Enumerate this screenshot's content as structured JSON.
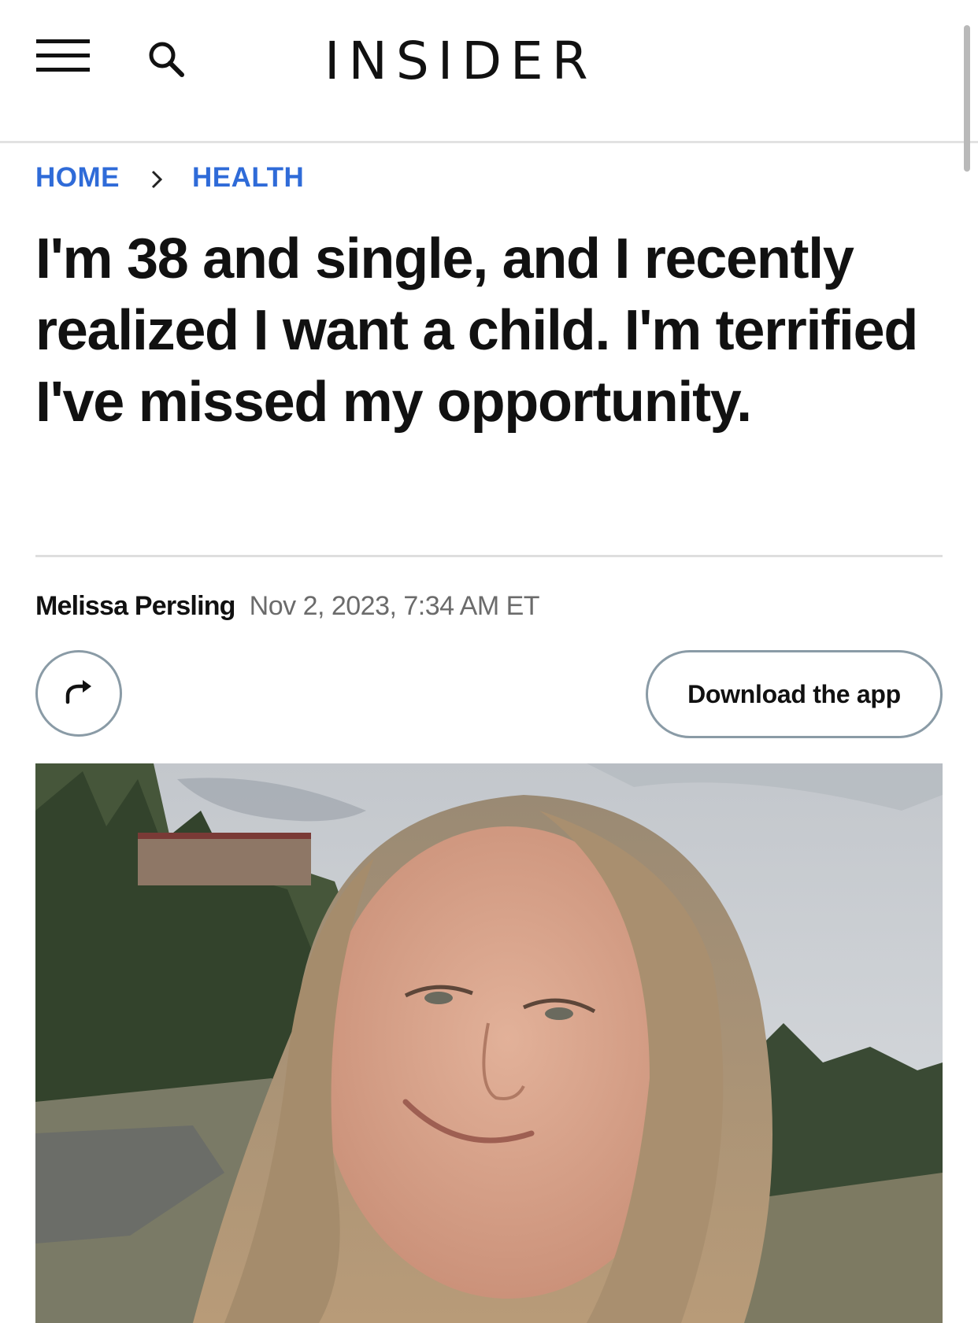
{
  "header": {
    "logo": "INSIDER",
    "menu_icon": "hamburger-menu-icon",
    "search_icon": "search-icon"
  },
  "breadcrumb": {
    "home": "HOME",
    "separator_icon": "chevron-right-icon",
    "section": "HEALTH"
  },
  "article": {
    "headline": "I'm 38 and single, and I recently realized I want a child. I'm terrified I've missed my opportunity.",
    "author": "Melissa Persling",
    "date": "Nov 2, 2023, 7:34 AM ET",
    "share_icon": "share-arrow-icon",
    "download_label": "Download the app",
    "photo_description_icon": "article-hero-photo"
  },
  "colors": {
    "link_blue": "#2f6bd8",
    "text": "#111111",
    "muted": "#6b6b6b",
    "button_border": "#8a9ba6"
  }
}
